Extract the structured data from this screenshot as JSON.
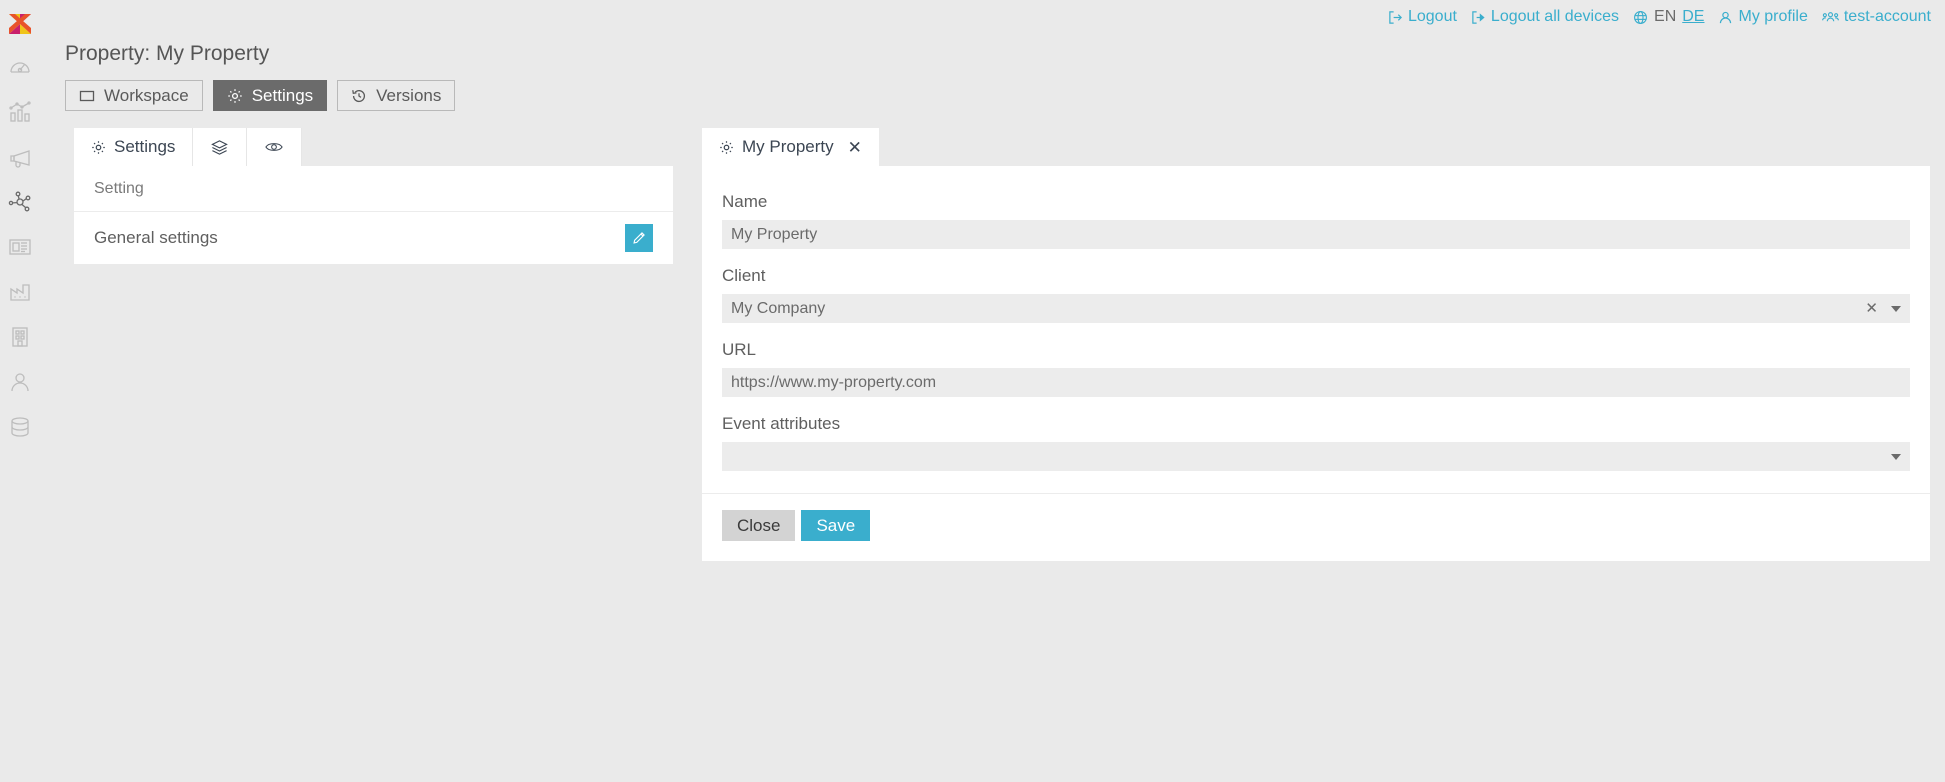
{
  "brand": {
    "logo_name": "app-logo",
    "accent": "#3aaecd"
  },
  "sidebar": {
    "items": [
      {
        "icon": "gauge-icon",
        "name": "dashboard",
        "active": false
      },
      {
        "icon": "bar-chart-icon",
        "name": "analytics",
        "active": false
      },
      {
        "icon": "megaphone-icon",
        "name": "campaigns",
        "active": false
      },
      {
        "icon": "network-nodes-icon",
        "name": "properties",
        "active": true
      },
      {
        "icon": "newspaper-icon",
        "name": "publishers",
        "active": false
      },
      {
        "icon": "factory-icon",
        "name": "advertisers",
        "active": false
      },
      {
        "icon": "building-icon",
        "name": "clients",
        "active": false
      },
      {
        "icon": "person-icon",
        "name": "users",
        "active": false
      },
      {
        "icon": "database-icon",
        "name": "data",
        "active": false
      }
    ]
  },
  "topnav": {
    "logout": "Logout",
    "logout_all": "Logout all devices",
    "lang_current": "EN",
    "lang_alt": "DE",
    "profile": "My profile",
    "account": "test-account"
  },
  "header": {
    "title": "Property: My Property",
    "tabs": [
      {
        "label": "Workspace",
        "icon": "window-icon",
        "active": false
      },
      {
        "label": "Settings",
        "icon": "gear-icon",
        "active": true
      },
      {
        "label": "Versions",
        "icon": "history-icon",
        "active": false
      }
    ]
  },
  "left_panel": {
    "tabs": [
      {
        "label": "Settings",
        "icon": "gear-icon",
        "active": true
      },
      {
        "label": "",
        "icon": "layers-icon",
        "active": false
      },
      {
        "label": "",
        "icon": "eye-icon",
        "active": false
      }
    ],
    "column_header": "Setting",
    "rows": [
      {
        "name": "General settings",
        "action": "edit-icon"
      }
    ]
  },
  "right_panel": {
    "tab": {
      "label": "My Property",
      "icon": "gear-icon",
      "close": "✕"
    },
    "fields": [
      {
        "label": "Name",
        "value": "My Property",
        "type": "text"
      },
      {
        "label": "Client",
        "value": "My Company",
        "type": "select",
        "clearable": true
      },
      {
        "label": "URL",
        "value": "https://www.my-property.com",
        "type": "text"
      },
      {
        "label": "Event attributes",
        "value": "",
        "type": "select",
        "clearable": false
      }
    ],
    "buttons": {
      "close": "Close",
      "save": "Save"
    }
  }
}
